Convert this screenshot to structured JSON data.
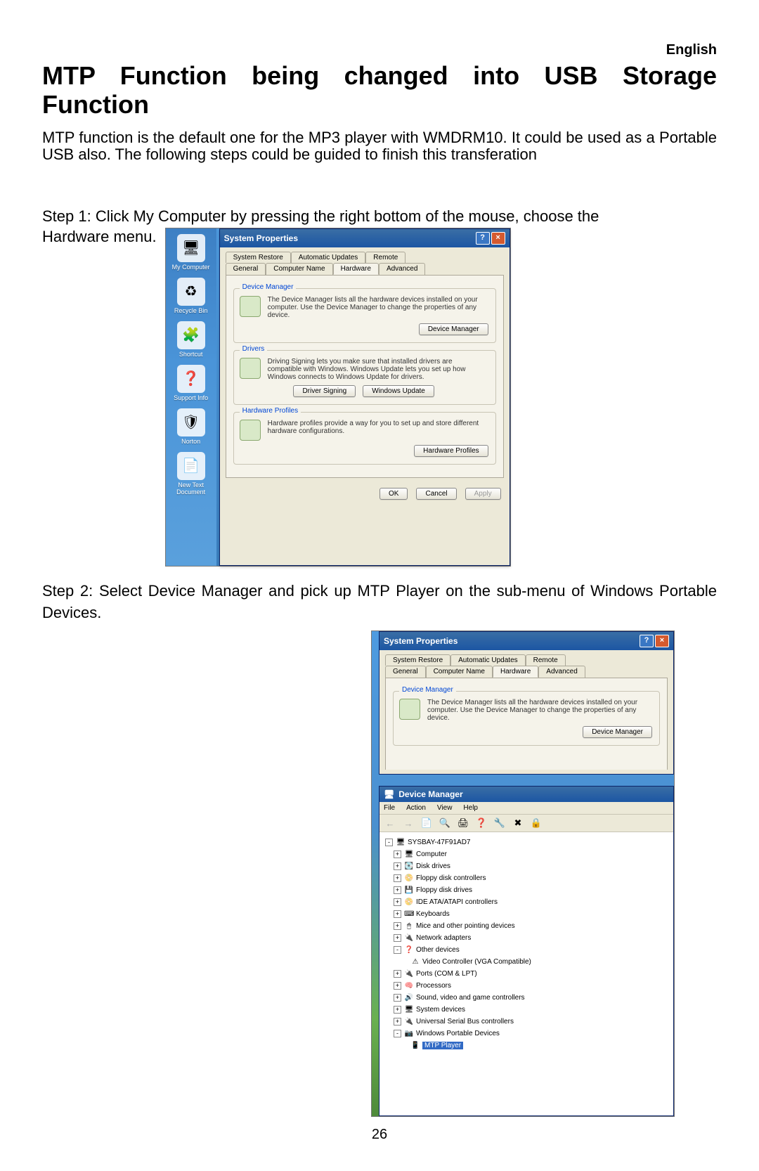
{
  "language_label": "English",
  "title": "MTP Function being changed into USB Storage Function",
  "intro": "MTP function is the default one for the MP3 player with WMDRM10. It could be used as a Portable USB also. The following steps could be guided to finish this transferation",
  "step1_line1": "Step 1: Click My Computer by pressing the right bottom of the mouse, choose the",
  "step1_line2": "Hardware menu.",
  "step2": "Step 2: Select Device Manager and pick up MTP Player on the sub-menu of Windows Portable Devices.",
  "page_number": "26",
  "desktop_icons": [
    {
      "glyph": "🖥",
      "label": "My Computer"
    },
    {
      "glyph": "♻",
      "label": "Recycle Bin"
    },
    {
      "glyph": "🧩",
      "label": "Shortcut"
    },
    {
      "glyph": "❓",
      "label": "Support Info"
    },
    {
      "glyph": "🛡",
      "label": "Norton"
    },
    {
      "glyph": "📄",
      "label": "New Text Document"
    }
  ],
  "sysprops": {
    "title": "System Properties",
    "tabs_row1": [
      "System Restore",
      "Automatic Updates",
      "Remote"
    ],
    "tabs_row2": [
      "General",
      "Computer Name",
      "Hardware",
      "Advanced"
    ],
    "active_tab": "Hardware",
    "dm_group": {
      "title": "Device Manager",
      "text": "The Device Manager lists all the hardware devices installed on your computer. Use the Device Manager to change the properties of any device.",
      "button": "Device Manager"
    },
    "drv_group": {
      "title": "Drivers",
      "text": "Driving Signing lets you make sure that installed drivers are compatible with Windows. Windows Update lets you set up how Windows connects to Windows Update for drivers.",
      "button1": "Driver Signing",
      "button2": "Windows Update"
    },
    "hw_group": {
      "title": "Hardware Profiles",
      "text": "Hardware profiles provide a way for you to set up and store different hardware configurations.",
      "button": "Hardware Profiles"
    },
    "ok": "OK",
    "cancel": "Cancel",
    "apply": "Apply"
  },
  "devmgr": {
    "title": "Device Manager",
    "menus": [
      "File",
      "Action",
      "View",
      "Help"
    ],
    "root": "SYSBAY-47F91AD7",
    "items": [
      {
        "label": "Computer",
        "glyph": "🖥"
      },
      {
        "label": "Disk drives",
        "glyph": "💽"
      },
      {
        "label": "Floppy disk controllers",
        "glyph": "📀"
      },
      {
        "label": "Floppy disk drives",
        "glyph": "💾"
      },
      {
        "label": "IDE ATA/ATAPI controllers",
        "glyph": "📀"
      },
      {
        "label": "Keyboards",
        "glyph": "⌨"
      },
      {
        "label": "Mice and other pointing devices",
        "glyph": "🖱"
      },
      {
        "label": "Network adapters",
        "glyph": "🔌"
      },
      {
        "label": "Other devices",
        "glyph": "❓",
        "expanded": true,
        "child": "Video Controller (VGA Compatible)"
      },
      {
        "label": "Ports (COM & LPT)",
        "glyph": "🔌"
      },
      {
        "label": "Processors",
        "glyph": "🧠"
      },
      {
        "label": "Sound, video and game controllers",
        "glyph": "🔊"
      },
      {
        "label": "System devices",
        "glyph": "🖥"
      },
      {
        "label": "Universal Serial Bus controllers",
        "glyph": "🔌"
      },
      {
        "label": "Windows Portable Devices",
        "glyph": "📷",
        "expanded": true,
        "child": "MTP Player",
        "selected": true
      }
    ]
  }
}
